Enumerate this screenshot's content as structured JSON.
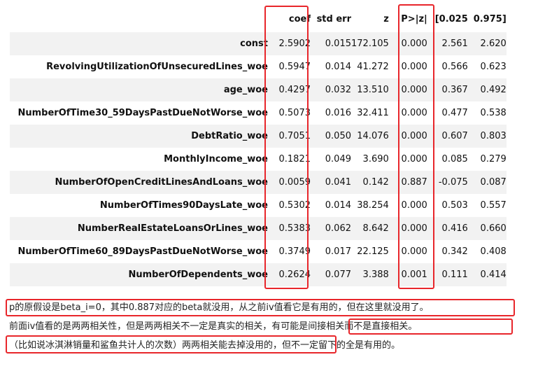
{
  "table": {
    "headers": [
      "",
      "coef",
      "std err",
      "z",
      "P>|z|",
      "[0.025",
      "0.975]"
    ],
    "rows": [
      {
        "name": "const",
        "values": [
          "2.5902",
          "0.015",
          "172.105",
          "0.000",
          "2.561",
          "2.620"
        ]
      },
      {
        "name": "RevolvingUtilizationOfUnsecuredLines_woe",
        "values": [
          "0.5947",
          "0.014",
          "41.272",
          "0.000",
          "0.566",
          "0.623"
        ]
      },
      {
        "name": "age_woe",
        "values": [
          "0.4297",
          "0.032",
          "13.510",
          "0.000",
          "0.367",
          "0.492"
        ]
      },
      {
        "name": "NumberOfTime30_59DaysPastDueNotWorse_woe",
        "values": [
          "0.5073",
          "0.016",
          "32.411",
          "0.000",
          "0.477",
          "0.538"
        ]
      },
      {
        "name": "DebtRatio_woe",
        "values": [
          "0.7051",
          "0.050",
          "14.076",
          "0.000",
          "0.607",
          "0.803"
        ]
      },
      {
        "name": "MonthlyIncome_woe",
        "values": [
          "0.1821",
          "0.049",
          "3.690",
          "0.000",
          "0.085",
          "0.279"
        ]
      },
      {
        "name": "NumberOfOpenCreditLinesAndLoans_woe",
        "values": [
          "0.0059",
          "0.041",
          "0.142",
          "0.887",
          "-0.075",
          "0.087"
        ]
      },
      {
        "name": "NumberOfTimes90DaysLate_woe",
        "values": [
          "0.5302",
          "0.014",
          "38.254",
          "0.000",
          "0.503",
          "0.557"
        ]
      },
      {
        "name": "NumberRealEstateLoansOrLines_woe",
        "values": [
          "0.5383",
          "0.062",
          "8.642",
          "0.000",
          "0.416",
          "0.660"
        ]
      },
      {
        "name": "NumberOfTime60_89DaysPastDueNotWorse_woe",
        "values": [
          "0.3749",
          "0.017",
          "22.125",
          "0.000",
          "0.342",
          "0.408"
        ]
      },
      {
        "name": "NumberOfDependents_woe",
        "values": [
          "0.2624",
          "0.077",
          "3.388",
          "0.001",
          "0.111",
          "0.414"
        ]
      }
    ]
  },
  "notes": {
    "line1": "p的原假设是beta_i=0，其中0.887对应的beta就没用，从之前iv值看它是有用的，但在这里就没用了。",
    "line2": "前面iv值看的是两两相关性，但是两两相关不一定是真实的相关，有可能是间接相关而不是直接相关。",
    "line3": "（比如说冰淇淋销量和鲨鱼共计人的次数）两两相关能去掉没用的，但不一定留下的全是有用的。"
  },
  "colors": {
    "highlight": "#e8262b",
    "stripe": "#f2f2f2"
  }
}
